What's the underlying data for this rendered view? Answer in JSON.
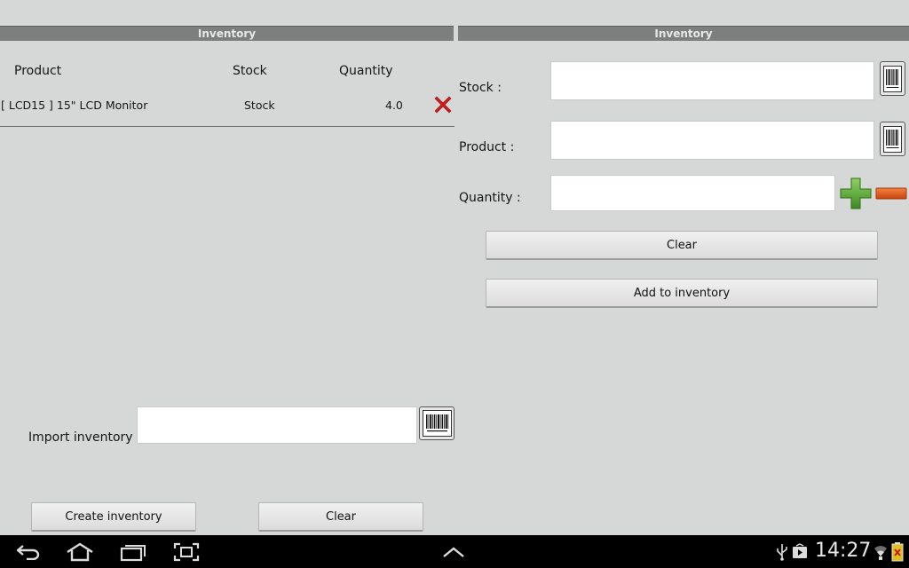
{
  "left_panel": {
    "title": "Inventory",
    "columns": [
      "Product",
      "Stock",
      "Quantity"
    ],
    "rows": [
      {
        "product": "[ LCD15 ] 15\" LCD Monitor",
        "stock": "Stock",
        "quantity": "4.0"
      }
    ],
    "import_label": "Import inventory",
    "import_value": "",
    "create_button": "Create inventory",
    "clear_button": "Clear"
  },
  "right_panel": {
    "title": "Inventory",
    "stock_label": "Stock :",
    "stock_value": "",
    "product_label": "Product :",
    "product_value": "",
    "quantity_label": "Quantity :",
    "quantity_value": "",
    "clear_button": "Clear",
    "add_button": "Add to inventory"
  },
  "status_bar": {
    "time": "14:27"
  },
  "colors": {
    "background": "#d6d7d7",
    "titlebar": "#7d7e7e",
    "delete": "#d01c1c",
    "plus": "#5aa83a",
    "minus": "#e2561c",
    "navbar": "#000000"
  },
  "icons": [
    "barcode-icon",
    "delete-icon",
    "plus-icon",
    "minus-icon",
    "back-icon",
    "home-icon",
    "recent-apps-icon",
    "screenshot-icon",
    "up-arrow-icon",
    "usb-icon",
    "media-icon",
    "wifi-icon",
    "battery-icon"
  ]
}
